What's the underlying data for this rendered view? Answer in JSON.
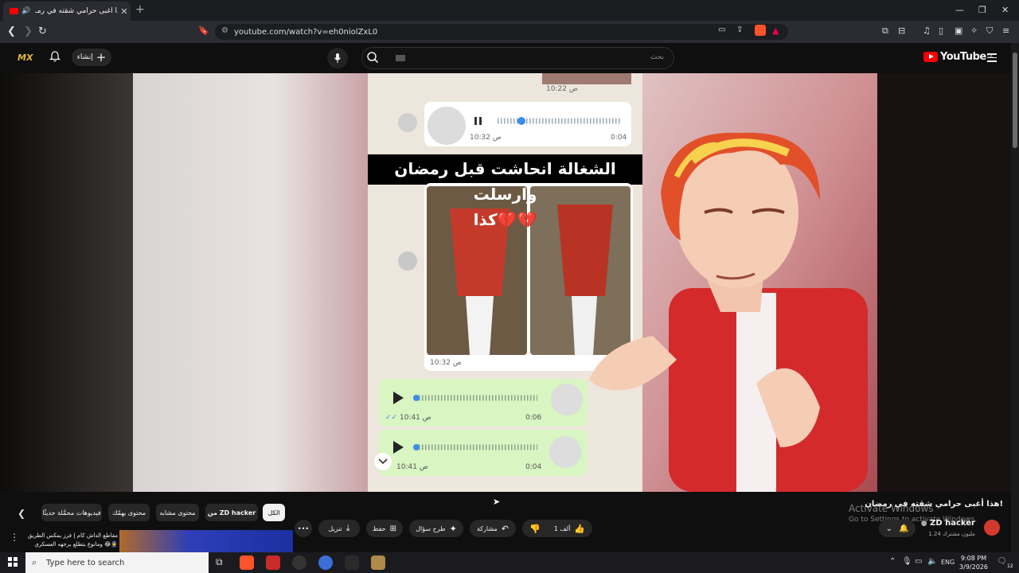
{
  "browser": {
    "tab_title": "هذا أغبى حرامي شقته في رمـ",
    "url": "youtube.com/watch?v=eh0niolZxL0"
  },
  "youtube": {
    "create_label": "إنشاء",
    "search_placeholder": "بحث",
    "logo_text": "YouTube",
    "logo_region": "SA",
    "brand_mark": "MX"
  },
  "video_frame": {
    "caption_line1": "الشغالة انحاشت قبل رمضان وارسلت",
    "caption_line2": "كذا💔💔",
    "msg_time_top": "10:22",
    "msg_suffix": "ص",
    "voice1_time": "10:32",
    "voice1_duration": "0:04",
    "images_time": "10:32",
    "voice2_time": "10:41",
    "voice2_duration": "0:06",
    "voice3_time": "10:41",
    "voice3_duration": "0:04"
  },
  "chips": [
    {
      "label": "الكل",
      "active": true
    },
    {
      "label": "من ZD hacker",
      "active": false
    },
    {
      "label": "محتوى مشابه",
      "active": false
    },
    {
      "label": "محتوى يهمّك",
      "active": false
    },
    {
      "label": "فيديوهات محمَّلة حديثًا",
      "active": false
    }
  ],
  "watermark": {
    "line1": "Activate Windows",
    "line2": "Go to Settings to activate Windows."
  },
  "video_info": {
    "title": "هذا أغبى حرامي شقته في رمضان!",
    "channel": "ZD hacker",
    "subscribers": "1.24 مليون مشترك",
    "likes": "1 ألف",
    "share": "مشاركة",
    "ask": "طرح سؤال",
    "save": "حفظ",
    "download": "تنزيل"
  },
  "recommended": {
    "title_line1": "مقاطع الداش كام | فرز يمكس الطريق",
    "title_line2": "ومانوع يتطلع برجهه العسكري 😂👮"
  },
  "taskbar": {
    "search_placeholder": "Type here to search",
    "lang": "ENG",
    "time": "9:08 PM",
    "date": "3/9/2026",
    "notif_count": "12"
  }
}
